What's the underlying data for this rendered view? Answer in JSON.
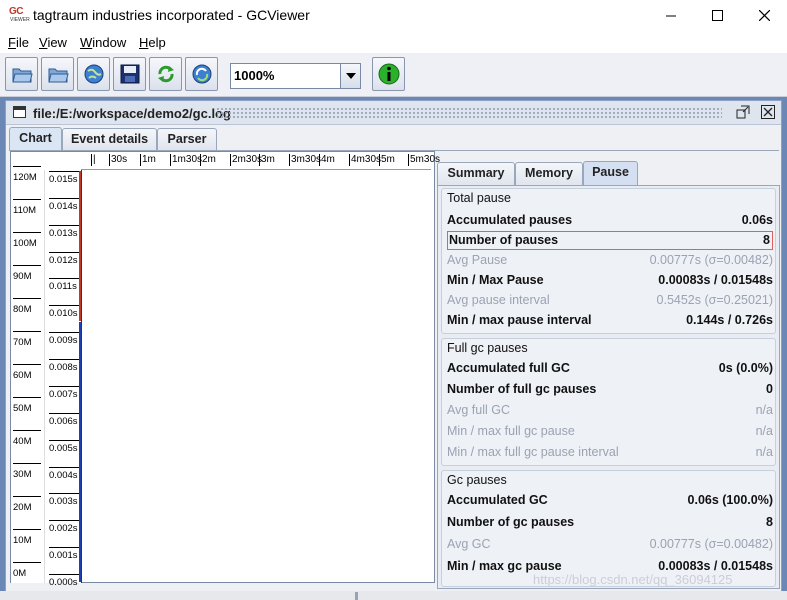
{
  "window": {
    "title": "tagtraum industries incorporated - GCViewer",
    "icon_text": "GC",
    "icon_subtext": "VIEWER",
    "controls": [
      "minimize-icon",
      "maximize-icon",
      "close-icon"
    ]
  },
  "menu": {
    "items": [
      {
        "label": "File",
        "mnemonic": "F",
        "rest": "ile"
      },
      {
        "label": "View",
        "mnemonic": "V",
        "rest": "iew"
      },
      {
        "label": "Window",
        "mnemonic": "W",
        "rest": "indow"
      },
      {
        "label": "Help",
        "mnemonic": "H",
        "rest": "elp"
      }
    ]
  },
  "toolbar": {
    "buttons": [
      "open-file-icon",
      "open-folder-icon",
      "open-url-icon",
      "save-icon",
      "refresh-icon",
      "watch-icon",
      "about-icon"
    ],
    "zoom_value": "1000%"
  },
  "internal_frame": {
    "path": "file:/E:/workspace/demo2/gc.log"
  },
  "tabs": [
    {
      "label": "Chart",
      "active": true
    },
    {
      "label": "Event details",
      "active": false
    },
    {
      "label": "Parser",
      "active": false
    }
  ],
  "chart": {
    "ruler_ticks": [
      "|",
      "30s",
      "1m",
      "1m30s",
      "2m",
      "2m30s",
      "3m",
      "3m30s",
      "4m",
      "4m30s",
      "5m",
      "5m30s"
    ],
    "memory_labels": [
      "120M",
      "110M",
      "100M",
      "90M",
      "80M",
      "70M",
      "60M",
      "50M",
      "40M",
      "30M",
      "20M",
      "10M",
      "0M"
    ],
    "time_labels": [
      "0.015s",
      "0.014s",
      "0.013s",
      "0.012s",
      "0.011s",
      "0.010s",
      "0.009s",
      "0.008s",
      "0.007s",
      "0.006s",
      "0.005s",
      "0.004s",
      "0.003s",
      "0.002s",
      "0.001s",
      "0.000s"
    ]
  },
  "right_tabs": [
    {
      "label": "Summary",
      "active": false
    },
    {
      "label": "Memory",
      "active": false
    },
    {
      "label": "Pause",
      "active": true
    }
  ],
  "pause": {
    "total": {
      "title": "Total pause",
      "rows": [
        {
          "k": "Accumulated pauses",
          "v": "0.06s",
          "dim": false
        },
        {
          "k": "Number of pauses",
          "v": "8",
          "dim": false,
          "highlight": true
        },
        {
          "k": "Avg Pause",
          "v": "0.00777s (σ=0.00482)",
          "dim": true
        },
        {
          "k": "Min / Max Pause",
          "v": "0.00083s / 0.01548s",
          "dim": false
        },
        {
          "k": "Avg pause interval",
          "v": "0.5452s (σ=0.25021)",
          "dim": true
        },
        {
          "k": "Min / max pause interval",
          "v": "0.144s / 0.726s",
          "dim": false
        }
      ]
    },
    "full": {
      "title": "Full gc pauses",
      "rows": [
        {
          "k": "Accumulated full GC",
          "v": "0s (0.0%)",
          "dim": false
        },
        {
          "k": "Number of full gc pauses",
          "v": "0",
          "dim": false
        },
        {
          "k": "Avg full GC",
          "v": "n/a",
          "dim": true
        },
        {
          "k": "Min / max full gc pause",
          "v": "n/a",
          "dim": true
        },
        {
          "k": "Min / max full gc pause interval",
          "v": "n/a",
          "dim": true
        }
      ]
    },
    "gc": {
      "title": "Gc pauses",
      "rows": [
        {
          "k": "Accumulated GC",
          "v": "0.06s (100.0%)",
          "dim": false
        },
        {
          "k": "Number of gc pauses",
          "v": "8",
          "dim": false
        },
        {
          "k": "Avg GC",
          "v": "0.00777s (σ=0.00482)",
          "dim": true
        },
        {
          "k": "Min / max gc pause",
          "v": "0.00083s / 0.01548s",
          "dim": false
        }
      ]
    }
  },
  "watermark": "https://blog.csdn.net/qq_36094125"
}
